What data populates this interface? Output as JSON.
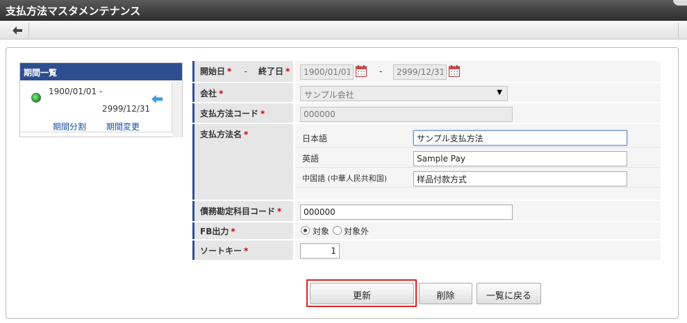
{
  "window": {
    "title": "支払方法マスタメンテナンス"
  },
  "period_panel": {
    "header": "期間一覧",
    "items": [
      {
        "start": "1900/01/01  -",
        "end": "2999/12/31"
      }
    ],
    "split_link": "期間分割",
    "change_link": "期間変更"
  },
  "form": {
    "period": {
      "start_label": "開始日",
      "end_label": "終了日",
      "separator": "-",
      "start_value": "1900/01/01",
      "end_value": "2999/12/31",
      "range_dash": "-"
    },
    "company": {
      "label": "会社",
      "value": "サンプル会社"
    },
    "payment_code": {
      "label": "支払方法コード",
      "value": "000000"
    },
    "payment_name": {
      "label": "支払方法名",
      "languages": [
        {
          "name": "日本語",
          "value": "サンプル支払方法"
        },
        {
          "name": "英語",
          "value": "Sample Pay"
        },
        {
          "name": "中国語 (中華人民共和国)",
          "value": "样品付款方式"
        }
      ]
    },
    "account_code": {
      "label": "債務勘定科目コード",
      "value": "000000"
    },
    "fb_output": {
      "label": "FB出力",
      "options": [
        "対象",
        "対象外"
      ],
      "selected": "対象"
    },
    "sort_key": {
      "label": "ソートキー",
      "value": "1"
    },
    "required_mark": "*"
  },
  "buttons": {
    "update": "更新",
    "delete": "削除",
    "back_to_list": "一覧に戻る"
  },
  "colors": {
    "accent": "#2e4f8f",
    "required": "#d00000",
    "highlight": "#dd2222"
  }
}
